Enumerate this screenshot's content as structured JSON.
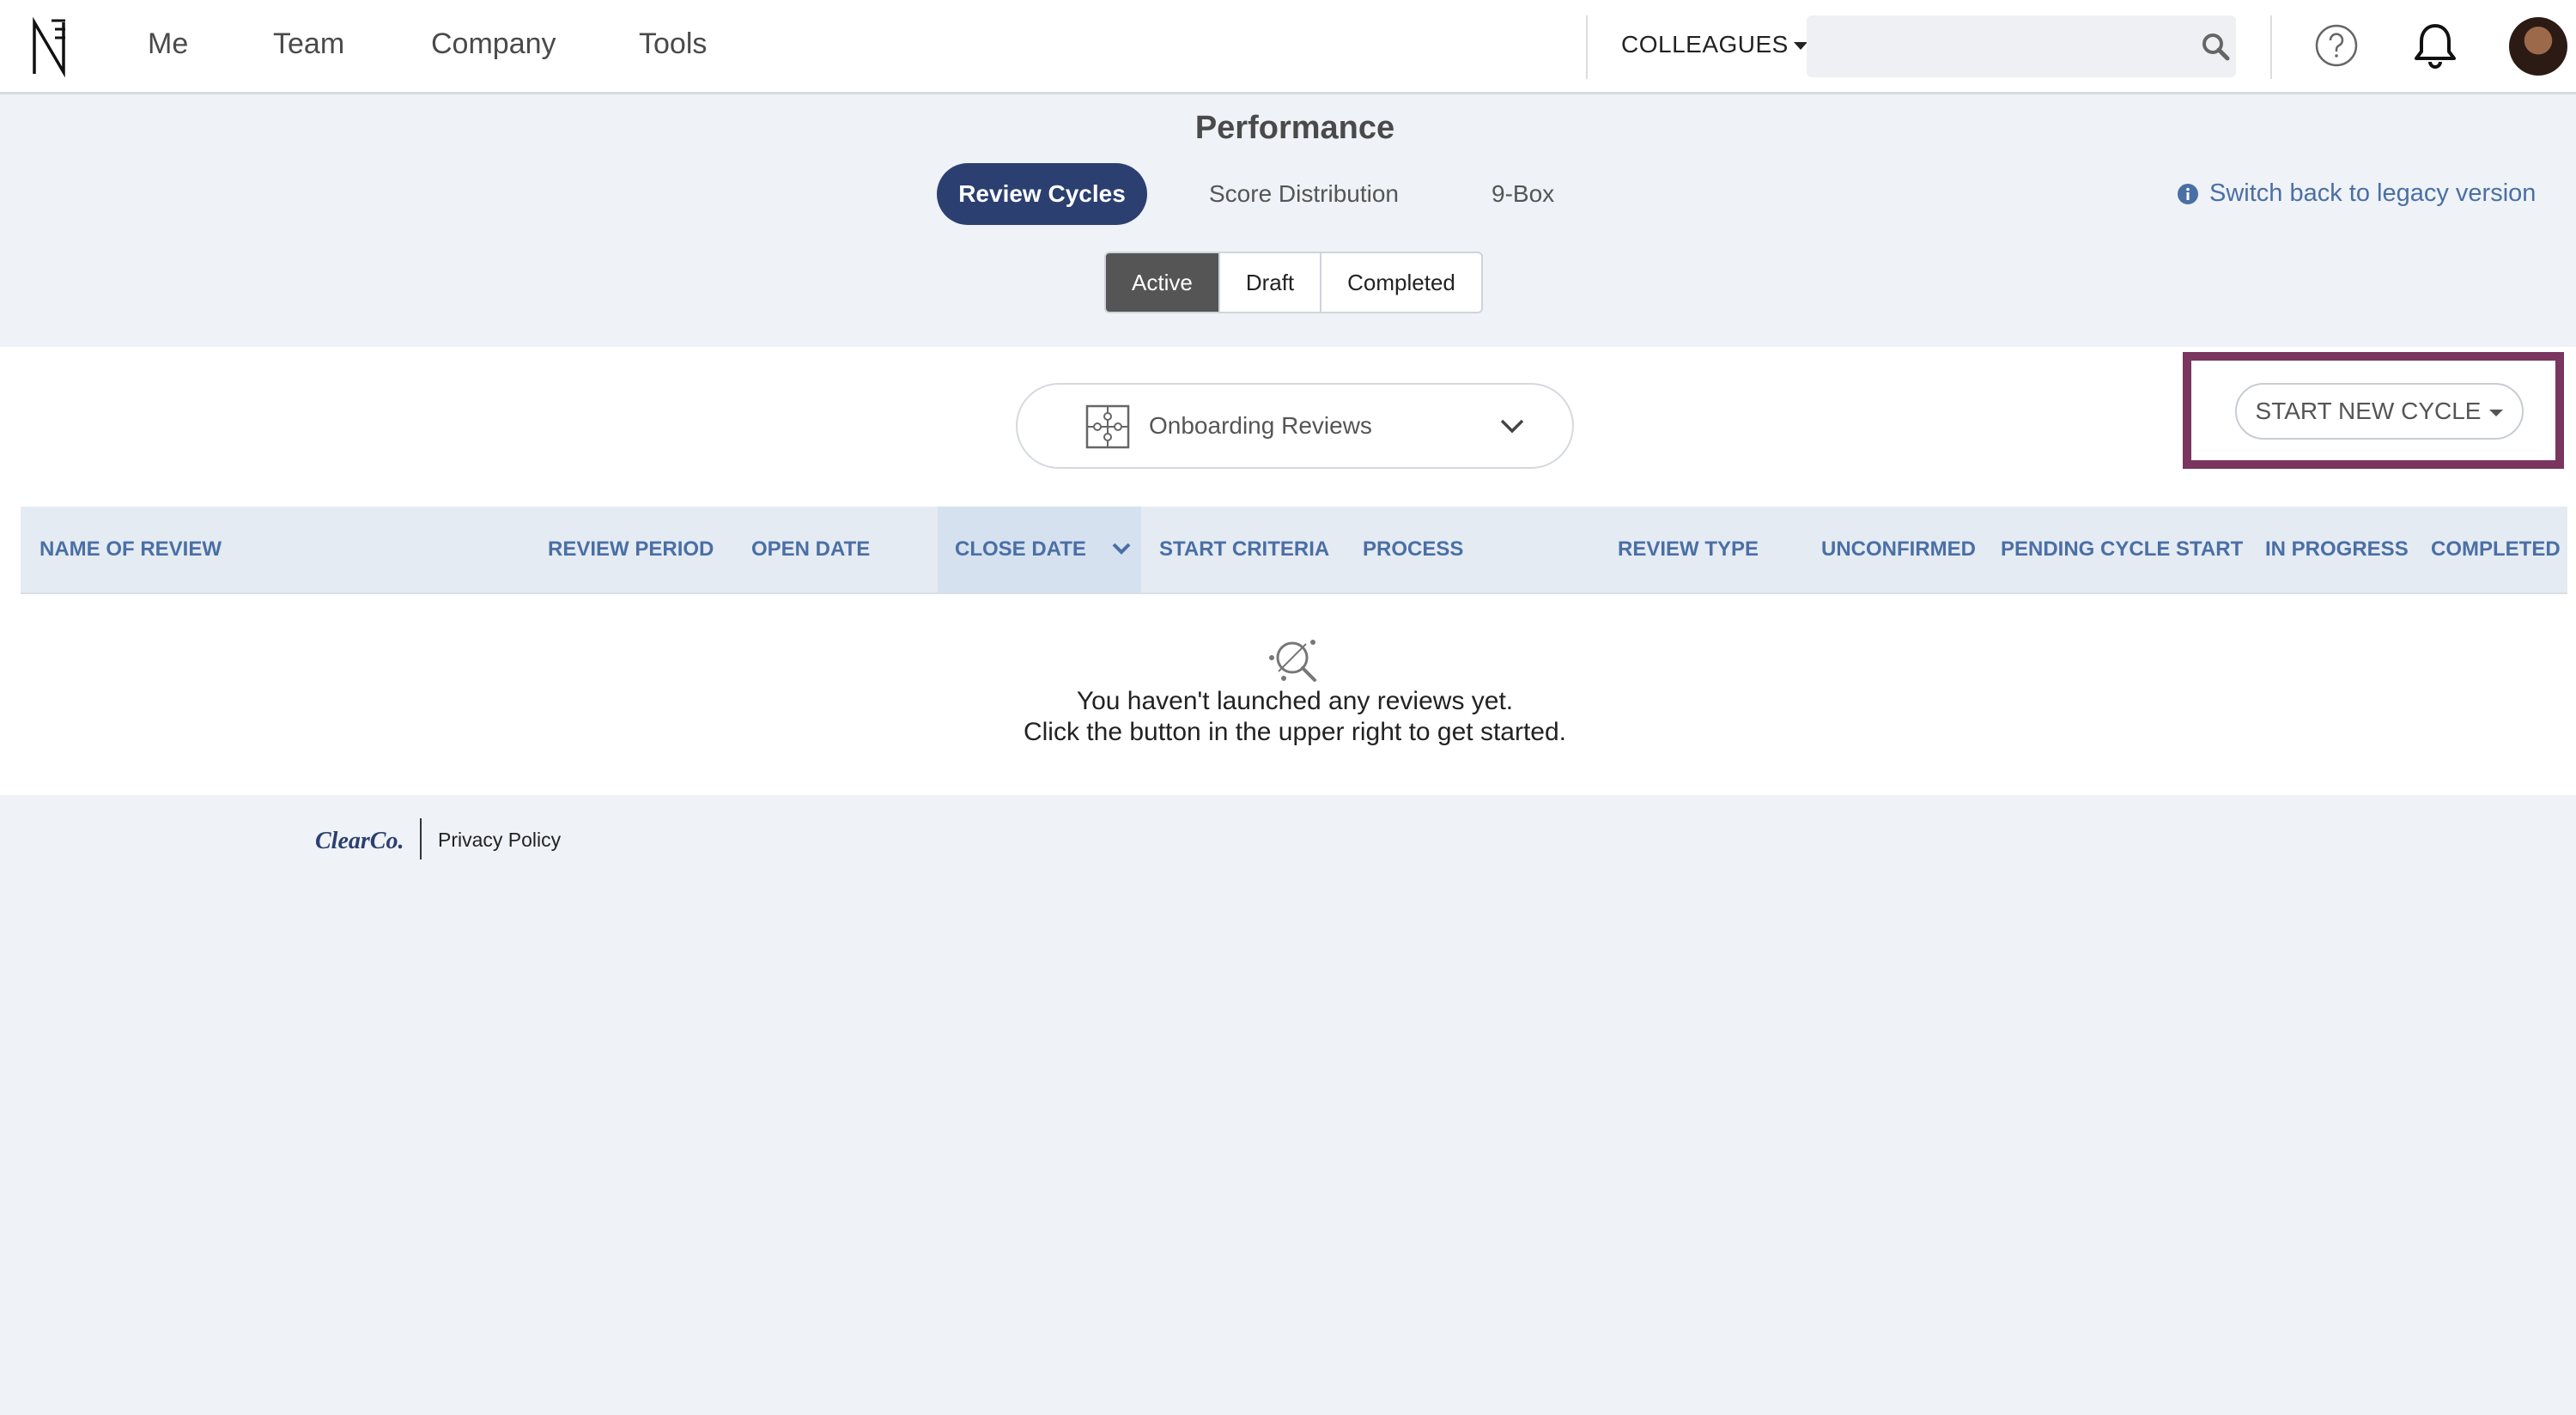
{
  "nav": {
    "items": [
      "Me",
      "Team",
      "Company",
      "Tools"
    ],
    "colleagues_label": "COLLEAGUES",
    "search_placeholder": ""
  },
  "page": {
    "title": "Performance",
    "tabs": [
      "Review Cycles",
      "Score Distribution",
      "9-Box"
    ],
    "active_tab": "Review Cycles",
    "legacy_link": "Switch back to legacy version",
    "status_filters": [
      "Active",
      "Draft",
      "Completed"
    ],
    "active_filter": "Active"
  },
  "panel": {
    "dropdown_label": "Onboarding Reviews",
    "start_button": "START NEW CYCLE",
    "columns": [
      "NAME OF REVIEW",
      "REVIEW PERIOD",
      "OPEN DATE",
      "CLOSE DATE",
      "START CRITERIA",
      "PROCESS",
      "REVIEW TYPE",
      "UNCONFIRMED",
      "PENDING CYCLE START",
      "IN PROGRESS",
      "COMPLETED"
    ],
    "sorted_column": "CLOSE DATE",
    "empty_line1": "You haven't launched any reviews yet.",
    "empty_line2": "Click the button in the upper right to get started."
  },
  "footer": {
    "brand": "ClearCo.",
    "privacy": "Privacy Policy"
  },
  "colors": {
    "primary": "#2b4070",
    "link": "#4a6fa5",
    "highlight_border": "#7a365f",
    "background": "#eff2f6"
  },
  "icons": [
    "logo-icon",
    "search-icon",
    "help-icon",
    "bell-icon",
    "info-icon",
    "puzzle-icon",
    "chevron-down-icon",
    "sort-desc-icon",
    "empty-search-icon"
  ]
}
